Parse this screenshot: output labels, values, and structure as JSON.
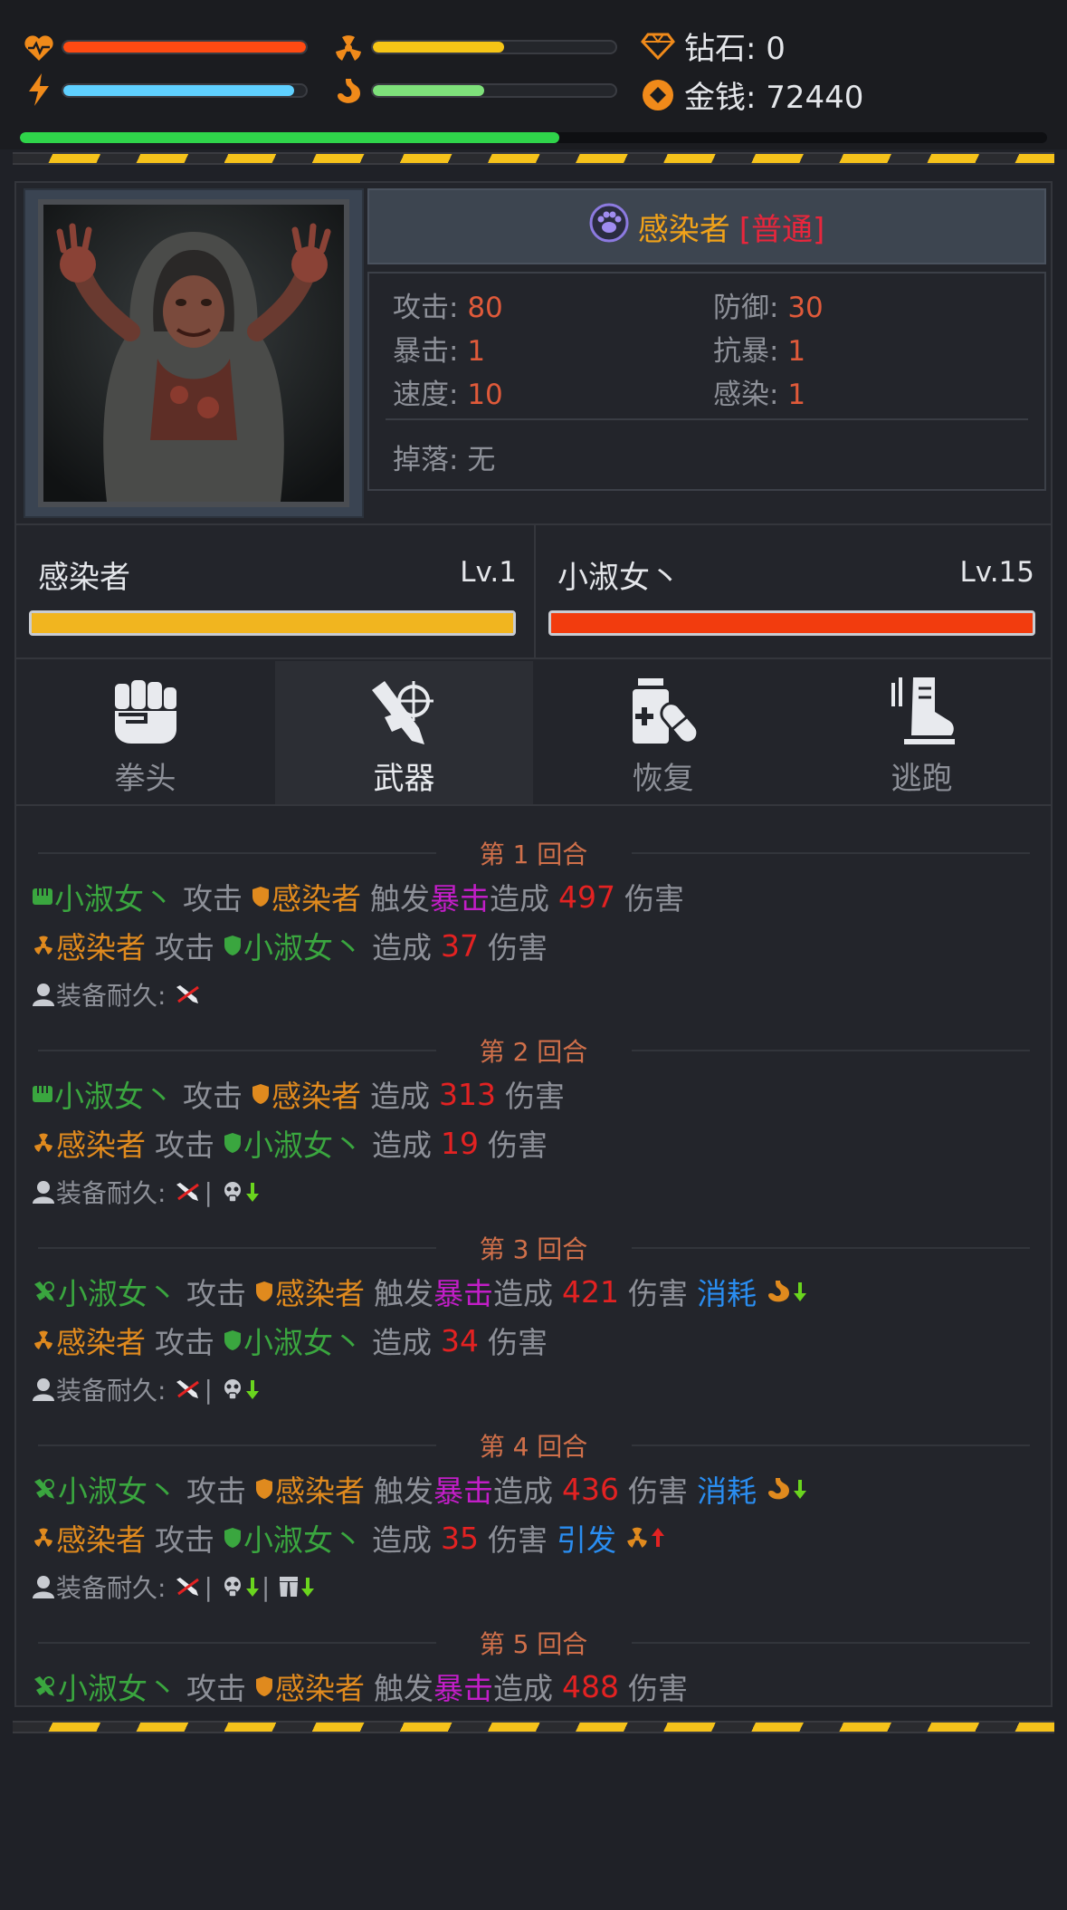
{
  "header": {
    "health": {
      "fill": 1.0,
      "color": "#ff4a12"
    },
    "radiation": {
      "fill": 0.54,
      "color": "#f6c516"
    },
    "energy": {
      "fill": 0.95,
      "color": "#5fd0ff"
    },
    "hunger": {
      "fill": 0.46,
      "color": "#7ee07a"
    },
    "experience_fill": 0.525,
    "diamond_label": "钻石: 0",
    "money_label": "金钱: 72440"
  },
  "enemy": {
    "name": "感染者",
    "rank": "[普通]",
    "stats": {
      "attack_label": "攻击: ",
      "attack": "80",
      "defense_label": "防御: ",
      "defense": "30",
      "crit_label": "暴击: ",
      "crit": "1",
      "crit_resist_label": "抗暴: ",
      "crit_resist": "1",
      "speed_label": "速度: ",
      "speed": "10",
      "infection_label": "感染: ",
      "infection": "1",
      "drop_label": "掉落: ",
      "drop": "无"
    }
  },
  "combatants": {
    "left": {
      "name": "感染者",
      "level": "Lv.1",
      "hp_fill": 1.0,
      "hp_color": "#f1b51f"
    },
    "right": {
      "name": "小淑女丶",
      "level": "Lv.15",
      "hp_fill": 1.0,
      "hp_color": "#f23c0e"
    }
  },
  "actions": [
    {
      "label": "拳头",
      "icon": "fist-icon",
      "active": false
    },
    {
      "label": "武器",
      "icon": "weapon-crosshair-icon",
      "active": true
    },
    {
      "label": "恢复",
      "icon": "medkit-icon",
      "active": false
    },
    {
      "label": "逃跑",
      "icon": "boot-icon",
      "active": false
    }
  ],
  "log": {
    "rounds": [
      {
        "title": "第 1 回合"
      },
      {
        "title": "第 2 回合"
      },
      {
        "title": "第 3 回合"
      },
      {
        "title": "第 4 回合"
      },
      {
        "title": "第 5 回合"
      }
    ],
    "player": "小淑女丶",
    "enemy": "感染者",
    "attack": "攻击",
    "trigger": "触发",
    "crit": "暴击",
    "deal": "造成",
    "damage": "伤害",
    "consume": "消耗",
    "cause": "引发",
    "durability": "装备耐久:",
    "sep": "|",
    "dmg": {
      "r1p": "497",
      "r1e": "37",
      "r2p": "313",
      "r2e": "19",
      "r3p": "421",
      "r3e": "34",
      "r4p": "436",
      "r4e": "35",
      "r5p": "488"
    }
  }
}
